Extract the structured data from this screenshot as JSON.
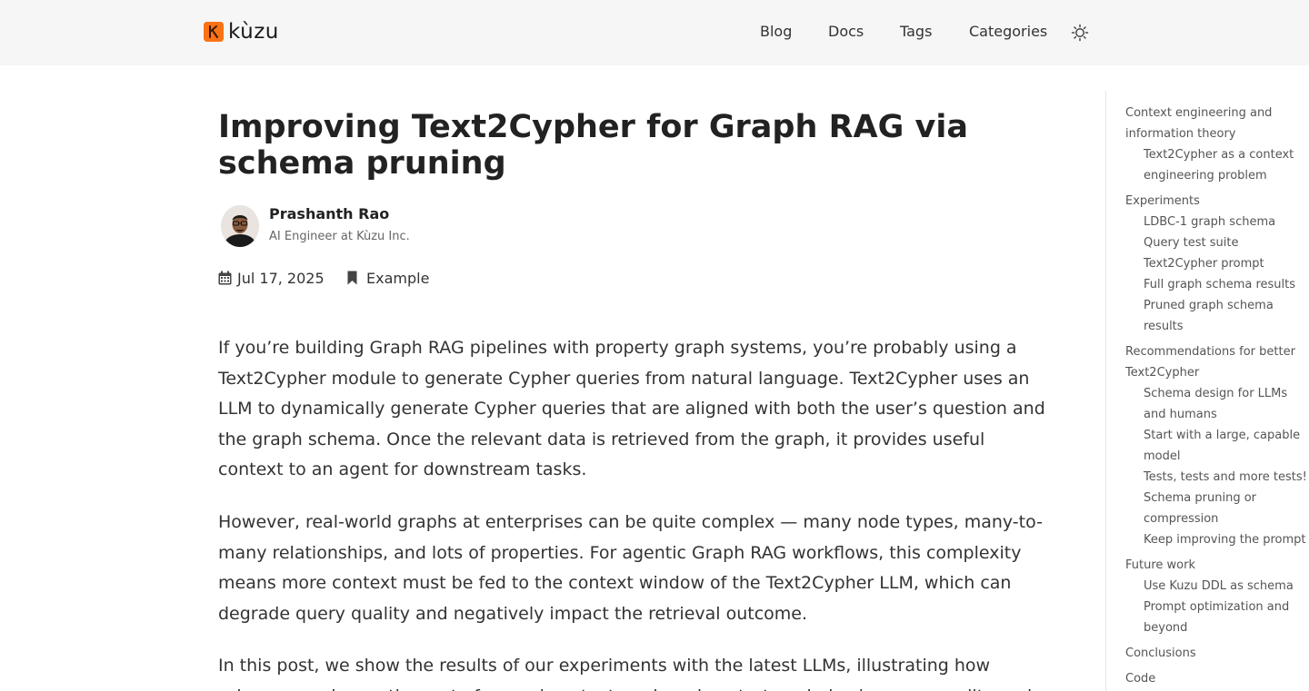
{
  "header": {
    "logo_text": "kùzu",
    "nav": [
      {
        "label": "Blog"
      },
      {
        "label": "Docs"
      },
      {
        "label": "Tags"
      },
      {
        "label": "Categories"
      }
    ],
    "theme_icon": "sun-icon"
  },
  "article": {
    "title_line1": "Improving Text2Cypher for Graph RAG via",
    "title_line2": "schema pruning",
    "author": {
      "name": "Prashanth Rao",
      "role": "AI Engineer at Kùzu Inc."
    },
    "date": "Jul 17, 2025",
    "category": "Example",
    "paragraphs": [
      {
        "lines": [
          "If you’re building Graph RAG pipelines with property graph systems, you’re probably using a",
          "Text2Cypher module to generate Cypher queries from natural language. Text2Cypher uses an",
          "LLM to dynamically generate Cypher queries that are aligned with both the user’s question and",
          "the graph schema. Once the relevant data is retrieved from the graph, it provides useful",
          "context to an agent for downstream tasks."
        ]
      },
      {
        "lines": [
          "However, real-world graphs at enterprises can be quite complex — many node types, many-to-",
          "many relationships, and lots of properties. For agentic Graph RAG workflows, this complexity",
          "means more context must be fed to the context window of the Text2Cypher LLM, which can",
          "degrade query quality and negatively impact the retrieval outcome."
        ]
      },
      {
        "lines": [
          "In this post, we show the results of our experiments with the latest LLMs, illustrating how",
          "schema pruning as the part of a good context engineering strategy helps improve quality and"
        ]
      }
    ]
  },
  "toc": [
    {
      "label": "Context engineering and",
      "indent": 0
    },
    {
      "label": "information theory",
      "indent": 0
    },
    {
      "label": "Text2Cypher as a context",
      "indent": 1
    },
    {
      "label": "engineering problem",
      "indent": 1
    },
    {
      "label": "Experiments",
      "indent": 0
    },
    {
      "label": "LDBC-1 graph schema",
      "indent": 1
    },
    {
      "label": "Query test suite",
      "indent": 1
    },
    {
      "label": "Text2Cypher prompt",
      "indent": 1
    },
    {
      "label": "Full graph schema results",
      "indent": 1
    },
    {
      "label": "Pruned graph schema",
      "indent": 1
    },
    {
      "label": "results",
      "indent": 1
    },
    {
      "label": "Recommendations for better",
      "indent": 0
    },
    {
      "label": "Text2Cypher",
      "indent": 0
    },
    {
      "label": "Schema design for LLMs",
      "indent": 1
    },
    {
      "label": "and humans",
      "indent": 1
    },
    {
      "label": "Start with a large, capable",
      "indent": 1
    },
    {
      "label": "model",
      "indent": 1
    },
    {
      "label": "Tests, tests and more tests!",
      "indent": 1
    },
    {
      "label": "Schema pruning or",
      "indent": 1
    },
    {
      "label": "compression",
      "indent": 1
    },
    {
      "label": "Keep improving the prompt",
      "indent": 1
    },
    {
      "label": "Future work",
      "indent": 0
    },
    {
      "label": "Use Kuzu DDL as schema",
      "indent": 1
    },
    {
      "label": "Prompt optimization and",
      "indent": 1
    },
    {
      "label": "beyond",
      "indent": 1
    },
    {
      "label": "Conclusions",
      "indent": 0
    },
    {
      "label": "Code",
      "indent": 0
    }
  ],
  "colors": {
    "brand": "#f97316",
    "header_bg": "#f6f6f6",
    "text": "#333333"
  }
}
